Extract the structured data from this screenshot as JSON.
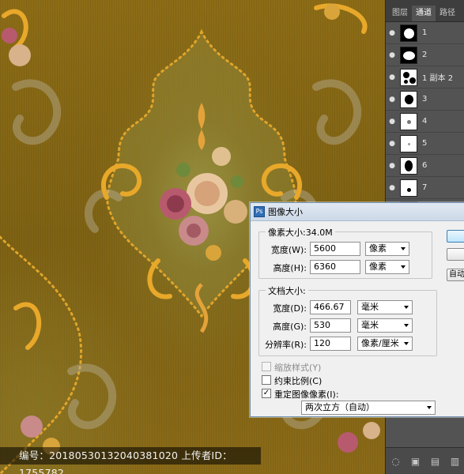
{
  "canvas": {
    "watermark_text": "编号：20180530132040381020 上传者ID：1755782"
  },
  "channels_panel": {
    "tabs": [
      "图层",
      "通道",
      "路径"
    ],
    "active_tab": "通道",
    "channels": [
      {
        "label": "1"
      },
      {
        "label": "2"
      },
      {
        "label": "1 副本 2"
      },
      {
        "label": "3"
      },
      {
        "label": "4"
      },
      {
        "label": "5"
      },
      {
        "label": "6"
      },
      {
        "label": "7"
      },
      {
        "label": "8"
      }
    ]
  },
  "dialog": {
    "title": "图像大小",
    "pixel_dimensions": {
      "label": "像素大小:34.0M",
      "width_label": "宽度(W):",
      "width_value": "5600",
      "width_unit": "像素",
      "height_label": "高度(H):",
      "height_value": "6360",
      "height_unit": "像素"
    },
    "document_size": {
      "label": "文档大小:",
      "width_label": "宽度(D):",
      "width_value": "466.67",
      "width_unit": "毫米",
      "height_label": "高度(G):",
      "height_value": "530",
      "height_unit": "毫米",
      "resolution_label": "分辨率(R):",
      "resolution_value": "120",
      "resolution_unit": "像素/厘米"
    },
    "options": {
      "scale_styles": {
        "label": "缩放样式(Y)",
        "checked": false,
        "disabled": true
      },
      "constrain_proportions": {
        "label": "约束比例(C)",
        "checked": false
      },
      "resample_image": {
        "label": "重定图像像素(I):",
        "checked": true
      },
      "resample_method": "两次立方（自动）"
    },
    "buttons": {
      "ok": "",
      "cancel": "",
      "auto": "自动"
    }
  },
  "colors": {
    "canvas_gold": "#8c6c16",
    "panel_bg": "#535353",
    "dialog_bg": "#f0f0f0",
    "dialog_border": "#6f8fb3"
  }
}
